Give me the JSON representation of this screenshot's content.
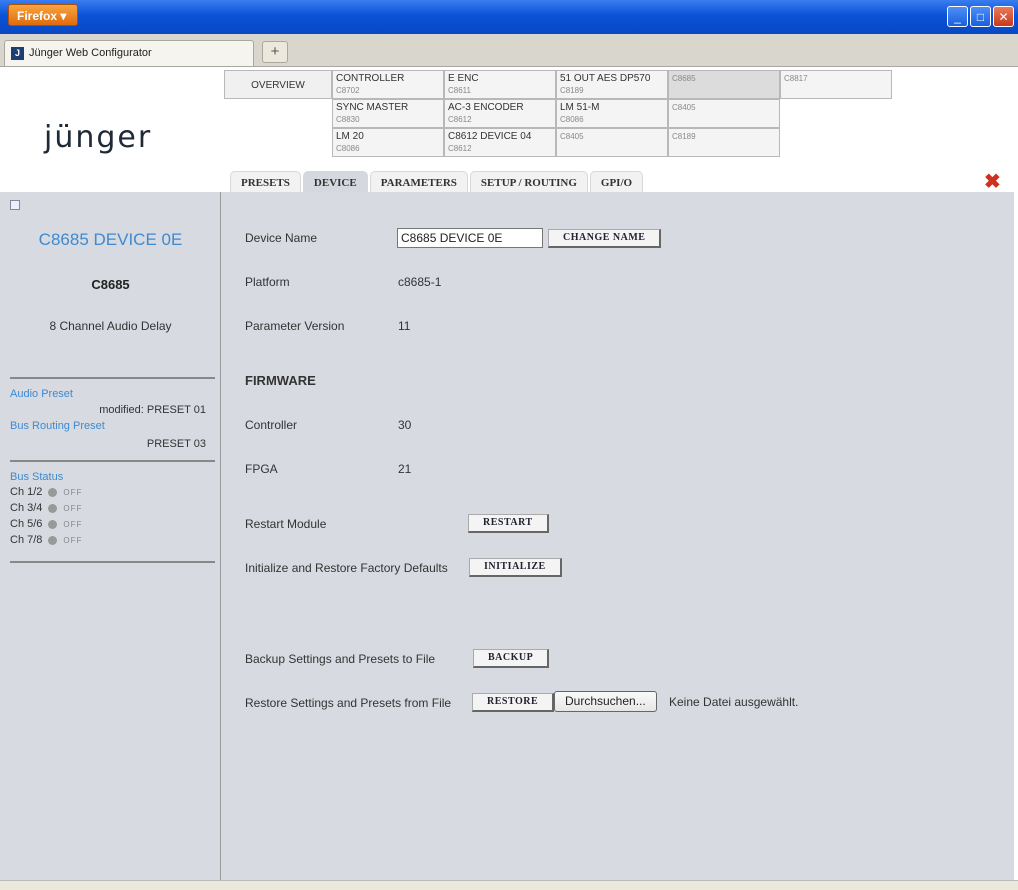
{
  "browser": {
    "app_button": "Firefox",
    "tab_title": "Jünger Web Configurator",
    "new_tab": "+"
  },
  "logo": "jünger",
  "devices": {
    "overview": "OVERVIEW",
    "cells": [
      {
        "name": "CONTROLLER",
        "code": "C8702"
      },
      {
        "name": "E ENC",
        "code": "C8611"
      },
      {
        "name": "51 OUT AES DP570",
        "code": "C8189"
      },
      {
        "name": "",
        "code": "C8685"
      },
      {
        "name": "",
        "code": "C8817"
      },
      {
        "name": "SYNC MASTER",
        "code": "C8830"
      },
      {
        "name": "AC-3 ENCODER",
        "code": "C8612"
      },
      {
        "name": "LM 51-M",
        "code": "C8086"
      },
      {
        "name": "",
        "code": "C8405"
      },
      {
        "name": "LM 20",
        "code": "C8086"
      },
      {
        "name": "C8612 DEVICE 04",
        "code": "C8612"
      },
      {
        "name": "",
        "code": "C8405"
      },
      {
        "name": "",
        "code": "C8189"
      }
    ]
  },
  "page_tabs": [
    "PRESETS",
    "DEVICE",
    "PARAMETERS",
    "SETUP / ROUTING",
    "GPI/O"
  ],
  "active_tab": "DEVICE",
  "left": {
    "device_name": "C8685 DEVICE 0E",
    "model": "C8685",
    "description": "8 Channel Audio Delay",
    "audio_preset_label": "Audio Preset",
    "audio_preset_value": "modified: PRESET 01",
    "bus_routing_label": "Bus Routing Preset",
    "bus_routing_value": "PRESET 03",
    "bus_status_label": "Bus Status",
    "bus_status": [
      {
        "ch": "Ch 1/2",
        "state": "OFF"
      },
      {
        "ch": "Ch 3/4",
        "state": "OFF"
      },
      {
        "ch": "Ch 5/6",
        "state": "OFF"
      },
      {
        "ch": "Ch 7/8",
        "state": "OFF"
      }
    ]
  },
  "main": {
    "device_name_label": "Device Name",
    "device_name_value": "C8685 DEVICE 0E",
    "change_name": "CHANGE NAME",
    "platform_label": "Platform",
    "platform_value": "c8685-1",
    "param_version_label": "Parameter Version",
    "param_version_value": "11",
    "firmware_heading": "FIRMWARE",
    "controller_label": "Controller",
    "controller_value": "30",
    "fpga_label": "FPGA",
    "fpga_value": "21",
    "restart_label": "Restart Module",
    "restart_btn": "RESTART",
    "initialize_label": "Initialize and Restore Factory Defaults",
    "initialize_btn": "INITIALIZE",
    "backup_label": "Backup Settings and Presets to File",
    "backup_btn": "BACKUP",
    "restore_label": "Restore Settings and Presets from File",
    "restore_btn": "RESTORE",
    "browse_btn": "Durchsuchen...",
    "no_file": "Keine Datei ausgewählt."
  }
}
